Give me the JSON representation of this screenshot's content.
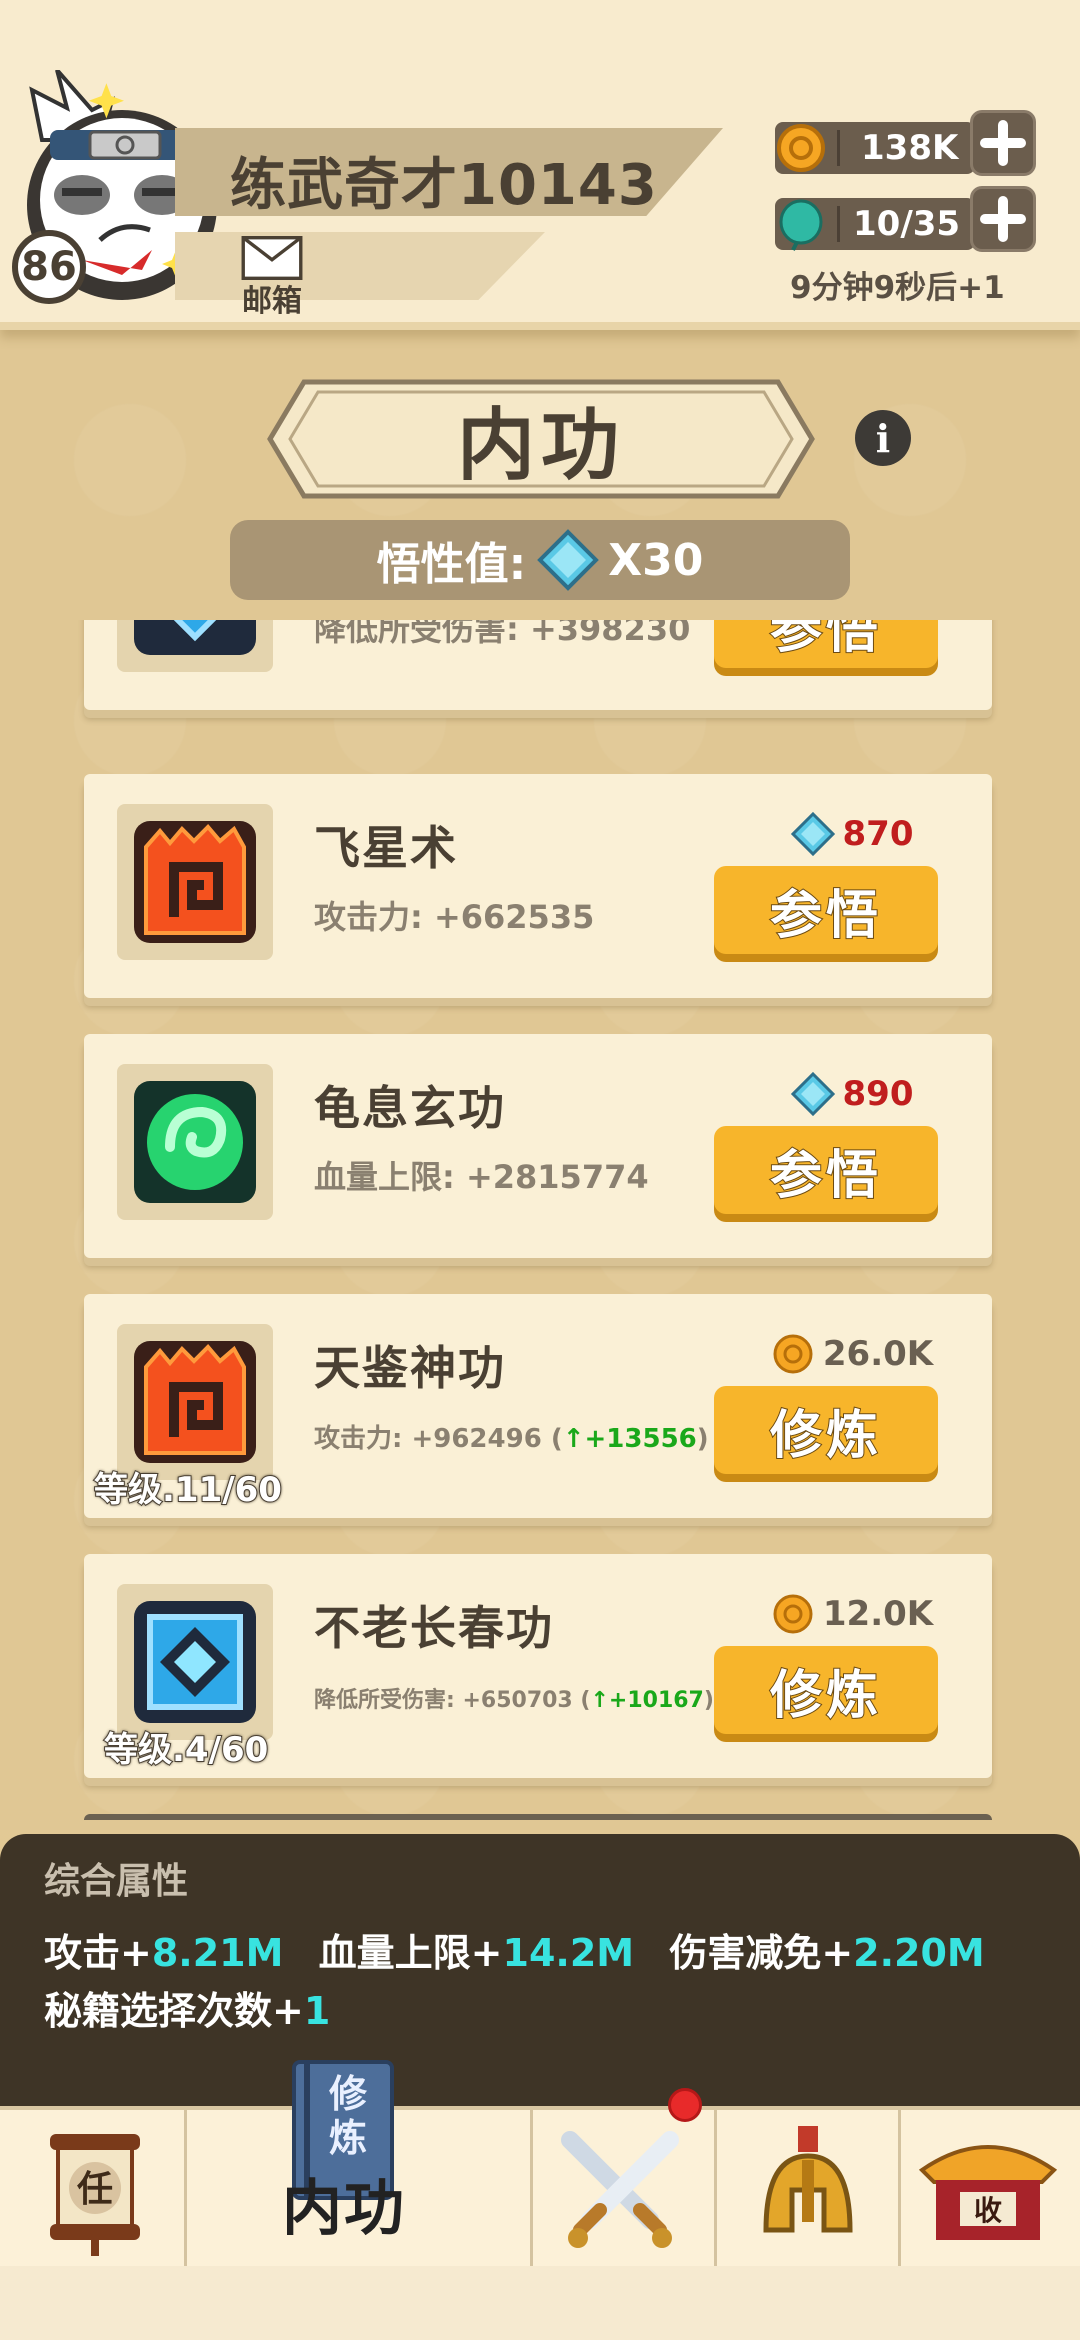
{
  "header": {
    "player_name": "练武奇才10143",
    "player_level": "86",
    "mail_label": "邮箱",
    "coins": "138K",
    "energy": "10/35",
    "energy_timer": "9分钟9秒后+1"
  },
  "page": {
    "title": "内功",
    "info_glyph": "i",
    "insight_label": "悟性值:",
    "insight_value": "X30"
  },
  "skills": [
    {
      "name": "",
      "stat_text": "降低所受伤害: +398230",
      "button_label": "参悟",
      "cost": "",
      "icon": "shield-sigil-icon"
    },
    {
      "name": "飞星术",
      "stat_text": "攻击力: +662535",
      "cost": "870",
      "cost_type": "insight",
      "button_label": "参悟",
      "icon": "flame-scroll-icon"
    },
    {
      "name": "龟息玄功",
      "stat_text": "血量上限: +2815774",
      "cost": "890",
      "cost_type": "insight",
      "button_label": "参悟",
      "icon": "green-orb-icon"
    },
    {
      "name": "天鉴神功",
      "stat_text": "攻击力: +962496 (",
      "stat_up": "+13556",
      "stat_close": ")",
      "cost": "26.0K",
      "cost_type": "coin",
      "button_label": "修炼",
      "level": "等级.11/60",
      "icon": "flame-scroll-icon"
    },
    {
      "name": "不老长春功",
      "stat_text": "降低所受伤害: +650703 (",
      "stat_up": "+10167",
      "stat_close": ")",
      "cost": "12.0K",
      "cost_type": "coin",
      "button_label": "修炼",
      "level": "等级.4/60",
      "icon": "shield-sigil-icon"
    }
  ],
  "summary": {
    "title": "综合属性",
    "atk_label": "攻击+",
    "atk_value": "8.21M",
    "hp_label": "血量上限+",
    "hp_value": "14.2M",
    "dr_label": "伤害减免+",
    "dr_value": "2.20M",
    "choices_label": "秘籍选择次数+",
    "choices_value": "1"
  },
  "nav": {
    "tasks_glyph": "任",
    "book_text": "修炼",
    "active_label": "内功",
    "shop_glyph": "收"
  },
  "colors": {
    "accent_button": "#f7b52b",
    "cost_red": "#c01e1e",
    "stat_up_green": "#1aa81a",
    "summary_cyan": "#38e3e0"
  }
}
